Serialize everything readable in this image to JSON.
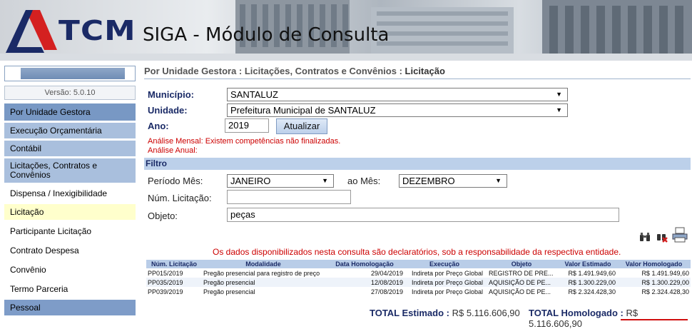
{
  "header": {
    "logo_text": "TCM",
    "app_title": "SIGA - Módulo de Consulta"
  },
  "sidebar": {
    "version": "Versão: 5.0.10",
    "items": [
      {
        "label": "Por Unidade Gestora"
      },
      {
        "label": "Execução Orçamentária"
      },
      {
        "label": "Contábil"
      },
      {
        "label": "Licitações, Contratos e Convênios"
      },
      {
        "label": "Dispensa / Inexigibilidade"
      },
      {
        "label": "Licitação"
      },
      {
        "label": "Participante Licitação"
      },
      {
        "label": "Contrato Despesa"
      },
      {
        "label": "Convênio"
      },
      {
        "label": "Termo Parceria"
      },
      {
        "label": "Pessoal"
      }
    ]
  },
  "breadcrumb": {
    "path": "Por Unidade Gestora : Licitações, Contratos e Convênios : ",
    "current": "Licitação"
  },
  "form": {
    "municipio_label": "Município:",
    "municipio_value": "SANTALUZ",
    "unidade_label": "Unidade:",
    "unidade_value": "Prefeitura Municipal de SANTALUZ",
    "ano_label": "Ano:",
    "ano_value": "2019",
    "atualizar_label": "Atualizar",
    "warn_mensal": "Análise Mensal: Existem competências não finalizadas.",
    "warn_anual": "Análise Anual:"
  },
  "filter": {
    "title": "Filtro",
    "periodo_label": "Período Mês:",
    "periodo_value": "JANEIRO",
    "ao_mes_label": "ao Mês:",
    "ao_mes_value": "DEZEMBRO",
    "num_label": "Núm. Licitação:",
    "num_value": "",
    "objeto_label": "Objeto:",
    "objeto_value": "peças"
  },
  "tools": [
    "binoculars-icon",
    "clear-search-icon",
    "print-icon"
  ],
  "disclaimer": "Os dados disponibilizados nesta consulta são declaratórios, sob a responsabilidade da respectiva entidade.",
  "table": {
    "columns": [
      "Núm. Licitação",
      "Modalidade",
      "Data Homologação",
      "Execução",
      "Objeto",
      "Valor Estimado",
      "Valor Homologado"
    ],
    "rows": [
      [
        "PP015/2019",
        "Pregão presencial para registro de preço",
        "29/04/2019",
        "Indireta por Preço Global",
        "REGISTRO DE PRE...",
        "R$ 1.491.949,60",
        "R$ 1.491.949,60"
      ],
      [
        "PP035/2019",
        "Pregão presencial",
        "12/08/2019",
        "Indireta por Preço Global",
        "AQUISIÇÃO DE PE...",
        "R$ 1.300.229,00",
        "R$ 1.300.229,00"
      ],
      [
        "PP039/2019",
        "Pregão presencial",
        "27/08/2019",
        "Indireta por Preço Global",
        "AQUISIÇÃO DE PE...",
        "R$ 2.324.428,30",
        "R$ 2.324.428,30"
      ]
    ]
  },
  "totals": {
    "estimado_label": "TOTAL Estimado :",
    "estimado_value": "R$ 5.116.606,90",
    "homologado_label": "TOTAL Homologado :",
    "homologado_value": "R$ 5.116.606,90"
  },
  "colors": {
    "brand_blue": "#1a2a66",
    "logo_red": "#d42020",
    "warning": "#cc0000",
    "nav_dark": "#7898c4",
    "nav_light": "#a9bfdd",
    "active": "#ffffcc"
  }
}
